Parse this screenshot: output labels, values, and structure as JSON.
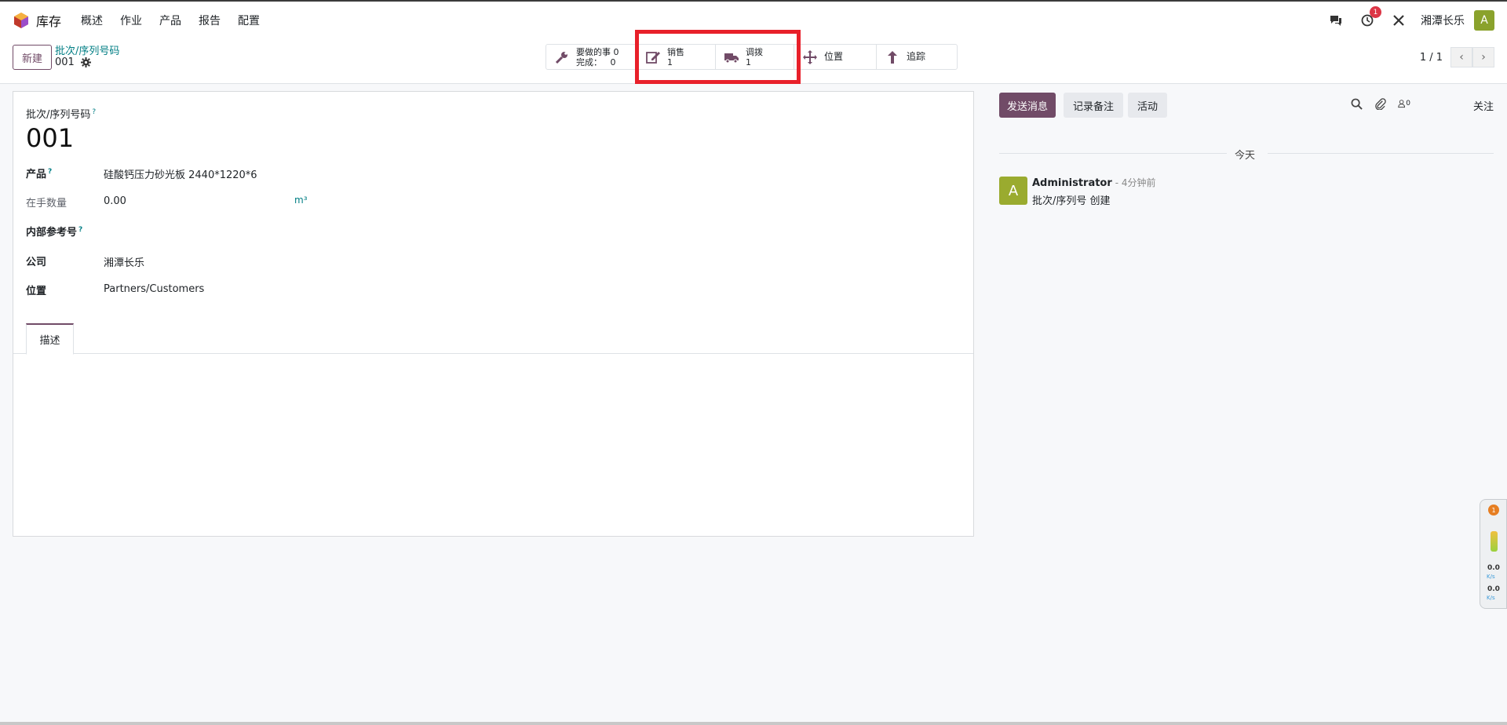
{
  "nav": {
    "app_name": "库存",
    "menu": [
      "概述",
      "作业",
      "产品",
      "报告",
      "配置"
    ],
    "activity_badge": "1",
    "company": "湘潭长乐",
    "user_initial": "A"
  },
  "control": {
    "new_label": "新建",
    "breadcrumb_parent": "批次/序列号码",
    "breadcrumb_current": "001",
    "smart_buttons": [
      {
        "label": "要做的事",
        "value": "0",
        "label2": "完成：",
        "value2": "0",
        "icon": "wrench-icon"
      },
      {
        "label": "销售",
        "value": "1",
        "icon": "edit-icon"
      },
      {
        "label": "调拨",
        "value": "1",
        "icon": "truck-icon"
      },
      {
        "label": "位置",
        "icon": "move-icon"
      },
      {
        "label": "追踪",
        "icon": "arrow-up-icon"
      }
    ],
    "pager_value": "1 / 1"
  },
  "form": {
    "name_label": "批次/序列号码",
    "name_value": "001",
    "product_label": "产品",
    "product_value": "硅酸钙压力砂光板 2440*1220*6",
    "qty_label": "在手数量",
    "qty_value": "0.00",
    "qty_unit": "m³",
    "ref_label": "内部参考号",
    "company_label": "公司",
    "company_value": "湘潭长乐",
    "location_label": "位置",
    "location_value": "Partners/Customers",
    "tab_description": "描述",
    "help_mark": "?"
  },
  "chatter": {
    "send_label": "发送消息",
    "note_label": "记录备注",
    "activity_label": "活动",
    "followers_count": "0",
    "follow_label": "关注",
    "date_separator": "今天",
    "message": {
      "avatar": "A",
      "author": "Administrator",
      "time": "- 4分钟前",
      "body": "批次/序列号 创建"
    }
  },
  "widget": {
    "badge": "1",
    "up_value": "0.0",
    "up_unit": "K/s",
    "down_value": "0.0",
    "down_unit": "K/s"
  },
  "colors": {
    "primary": "#714b67",
    "link": "#017e84",
    "highlight": "#e8202a",
    "avatar": "#9aab2f"
  }
}
